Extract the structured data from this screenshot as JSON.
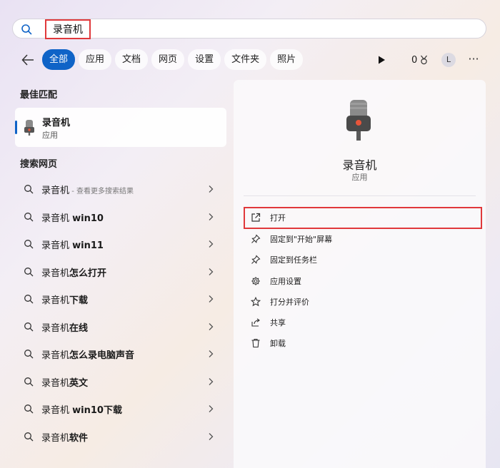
{
  "search": {
    "query": "录音机"
  },
  "filters": {
    "chips": [
      "全部",
      "应用",
      "文档",
      "网页",
      "设置",
      "文件夹",
      "照片"
    ],
    "active_index": 0,
    "points": "0",
    "avatar_letter": "L",
    "more_label": "···"
  },
  "best_match": {
    "title": "最佳匹配",
    "name": "录音机",
    "type": "应用"
  },
  "web": {
    "title": "搜索网页",
    "items": [
      {
        "prefix": "录音机",
        "bold": "",
        "hint": " - 查看更多搜索结果"
      },
      {
        "prefix": "录音机 ",
        "bold": "win10",
        "hint": ""
      },
      {
        "prefix": "录音机 ",
        "bold": "win11",
        "hint": ""
      },
      {
        "prefix": "录音机",
        "bold": "怎么打开",
        "hint": ""
      },
      {
        "prefix": "录音机",
        "bold": "下载",
        "hint": ""
      },
      {
        "prefix": "录音机",
        "bold": "在线",
        "hint": ""
      },
      {
        "prefix": "录音机",
        "bold": "怎么录电脑声音",
        "hint": ""
      },
      {
        "prefix": "录音机",
        "bold": "英文",
        "hint": ""
      },
      {
        "prefix": "录音机 ",
        "bold": "win10下载",
        "hint": ""
      },
      {
        "prefix": "录音机",
        "bold": "软件",
        "hint": ""
      }
    ]
  },
  "detail": {
    "name": "录音机",
    "type": "应用",
    "actions": [
      {
        "label": "打开",
        "icon": "open-external-icon"
      },
      {
        "label": "固定到\"开始\"屏幕",
        "icon": "pin-icon"
      },
      {
        "label": "固定到任务栏",
        "icon": "pin-icon"
      },
      {
        "label": "应用设置",
        "icon": "gear-icon"
      },
      {
        "label": "打分并评价",
        "icon": "star-icon"
      },
      {
        "label": "共享",
        "icon": "share-icon"
      },
      {
        "label": "卸载",
        "icon": "trash-icon"
      }
    ]
  },
  "colors": {
    "accent": "#0f63c7",
    "highlight": "#e0383b"
  }
}
